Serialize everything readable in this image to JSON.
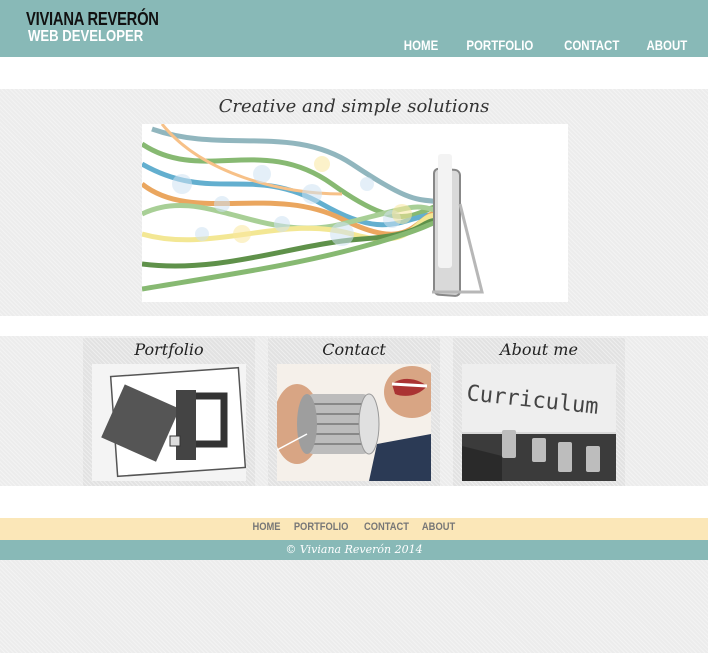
{
  "header": {
    "name": "VIVIANA REVERÓN",
    "role": "WEB DEVELOPER",
    "nav": [
      "HOME",
      "PORTFOLIO",
      "CONTACT",
      "ABOUT"
    ]
  },
  "hero": {
    "title": "Creative and simple solutions",
    "image": "ribbons-flowing-from-monitor"
  },
  "cards": [
    {
      "title": "Portfolio",
      "image": "folders"
    },
    {
      "title": "Contact",
      "image": "tin-can-phone"
    },
    {
      "title": "About me",
      "image": "curriculum-typewriter"
    }
  ],
  "footer": {
    "nav": [
      "HOME",
      "PORTFOLIO",
      "CONTACT",
      "ABOUT"
    ],
    "copyright": "© Viviana Reverón 2014"
  },
  "colors": {
    "teal": "#88b9b7",
    "cream": "#fbe7b8",
    "background": "#ececec"
  }
}
